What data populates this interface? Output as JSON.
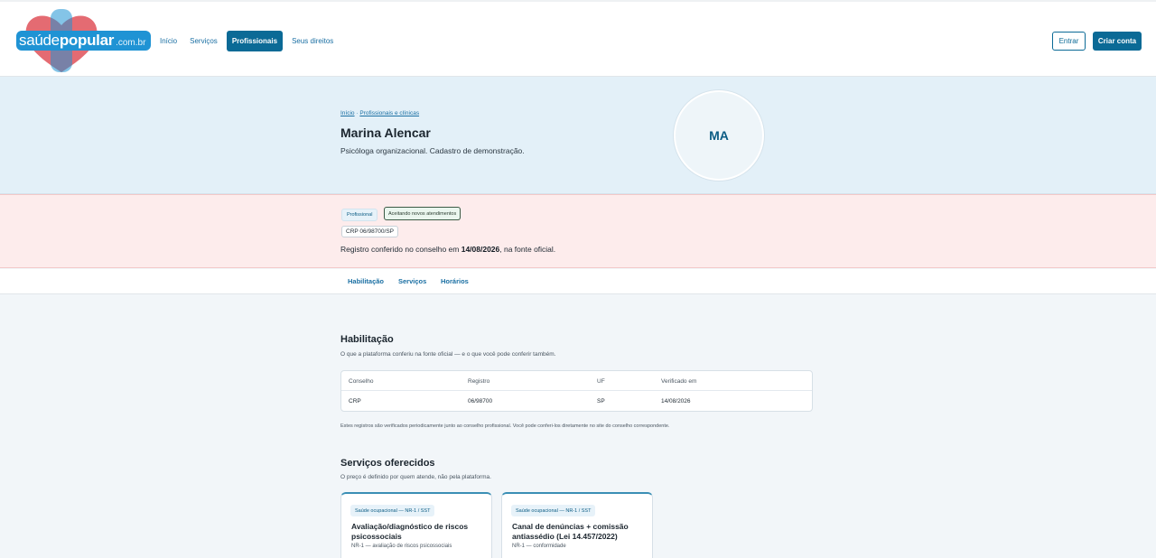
{
  "brand": {
    "logo_part1": "saúde",
    "logo_part2": "popular",
    "logo_part3": ".com.br",
    "colors": {
      "primary": "#0b6a96",
      "logo_blue": "#1f93d4",
      "heart_red": "#e0565e"
    }
  },
  "nav": {
    "items": [
      {
        "label": "Início",
        "active": false
      },
      {
        "label": "Serviços",
        "active": false
      },
      {
        "label": "Profissionais",
        "active": true
      },
      {
        "label": "Seus direitos",
        "active": false
      }
    ],
    "login_label": "Entrar",
    "signup_label": "Criar conta"
  },
  "profile": {
    "breadcrumb_home": "Início",
    "breadcrumb_sep": " · ",
    "breadcrumb_current": "Profissionais e clínicas",
    "name": "Marina Alencar",
    "description": "Psicóloga organizacional. Cadastro de demonstração.",
    "initials": "MA"
  },
  "status": {
    "badge_type": "Profissional",
    "badge_availability": "Aceitando novos atendimentos",
    "registry_badge": "CRP 06/98700/SP",
    "text_before": "Registro conferido no conselho em ",
    "date": "14/08/2026",
    "text_after": ", na fonte oficial."
  },
  "tabs": [
    "Habilitação",
    "Serviços",
    "Horários"
  ],
  "habilitacao": {
    "title": "Habilitação",
    "subtitle": "O que a plataforma conferiu na fonte oficial — e o que você pode conferir também.",
    "columns": [
      "Conselho",
      "Registro",
      "UF",
      "Verificado em"
    ],
    "rows": [
      [
        "CRP",
        "06/98700",
        "SP",
        "14/08/2026"
      ]
    ],
    "note": "Estes registros são verificados periodicamente junto ao conselho profissional. Você pode conferi-los diretamente no site do conselho correspondente."
  },
  "servicos": {
    "title": "Serviços oferecidos",
    "subtitle": "O preço é definido por quem atende, não pela plataforma.",
    "cards": [
      {
        "badge": "Saúde ocupacional — NR-1 / SST",
        "title": "Avaliação/diagnóstico de riscos psicossociais",
        "subtitle": "NR-1 — avaliação de riscos psicossociais"
      },
      {
        "badge": "Saúde ocupacional — NR-1 / SST",
        "title": "Canal de denúncias + comissão antiassédio (Lei 14.457/2022)",
        "subtitle": "NR-1 — conformidade"
      }
    ]
  }
}
